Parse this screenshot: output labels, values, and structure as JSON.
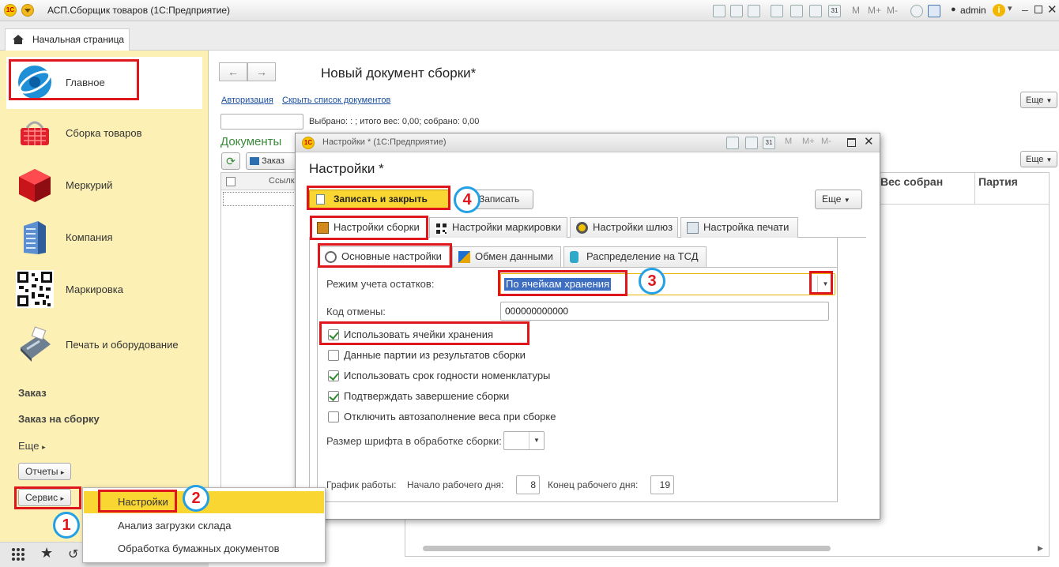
{
  "app": {
    "title": "АСП.Сборщик товаров  (1С:Предприятие)",
    "user": "admin",
    "zoom_buttons": [
      "M",
      "M+",
      "M-"
    ]
  },
  "home_tab": {
    "label": "Начальная страница"
  },
  "sidebar": {
    "sections": [
      {
        "label": "Главное",
        "icon": "main-section-icon"
      },
      {
        "label": "Сборка товаров",
        "icon": "basket-icon"
      },
      {
        "label": "Меркурий",
        "icon": "cube-icon"
      },
      {
        "label": "Компания",
        "icon": "building-icon"
      },
      {
        "label": "Маркировка",
        "icon": "qr-code-icon"
      },
      {
        "label": "Печать и оборудование",
        "icon": "pos-terminal-icon"
      }
    ],
    "links": [
      "Заказ",
      "Заказ на сборку"
    ],
    "more_label": "Еще",
    "reports_label": "Отчеты",
    "service_label": "Сервис"
  },
  "main": {
    "title": "Новый документ сборки*",
    "links": {
      "auth": "Авторизация",
      "hide_list": "Скрыть список документов"
    },
    "more_label": "Еще",
    "selected_text": "Выбрано: : ; итого вес: 0,00; собрано: 0,00",
    "docs_label": "Документы",
    "order_button": "Заказ",
    "col_link": "Ссылк",
    "col_weight": "Вес собран",
    "col_batch": "Партия"
  },
  "dialog": {
    "window_title": "Настройки * (1С:Предприятие)",
    "header": "Настройки *",
    "save_close": "Записать и закрыть",
    "save": "Записать",
    "more": "Еще",
    "tabs": [
      "Настройки сборки",
      "Настройки маркировки",
      "Настройки шлюз",
      "Настройка печати"
    ],
    "subtabs": [
      "Основные настройки",
      "Обмен данными",
      "Распределение на ТСД"
    ],
    "mode_label": "Режим учета остатков:",
    "mode_value": "По ячейкам хранения",
    "cancel_label": "Код отмены:",
    "cancel_value": "000000000000",
    "checkboxes": [
      {
        "label": "Использовать ячейки хранения",
        "checked": true
      },
      {
        "label": "Данные партии из результатов сборки",
        "checked": false
      },
      {
        "label": "Использовать срок годности номенклатуры",
        "checked": true
      },
      {
        "label": "Подтверждать завершение сборки",
        "checked": true
      },
      {
        "label": "Отключить автозаполнение веса при сборке",
        "checked": false
      }
    ],
    "font_size_label": "Размер шрифта в обработке сборки:",
    "schedule_label": "График работы:",
    "start_label": "Начало рабочего дня:",
    "start_value": "8",
    "end_label": "Конец рабочего дня:",
    "end_value": "19"
  },
  "popup_menu": {
    "items": [
      "Настройки",
      "Анализ загрузки склада",
      "Обработка бумажных документов"
    ]
  },
  "annotations": {
    "markers": [
      "1",
      "2",
      "3",
      "4"
    ]
  },
  "colors": {
    "sidebar_bg": "#fcf0b4",
    "highlight": "#f9d632",
    "accent_red": "#e0161d",
    "marker_blue": "#24a0e4",
    "link_blue": "#1a4fa0",
    "docs_green": "#3a8a3a"
  }
}
